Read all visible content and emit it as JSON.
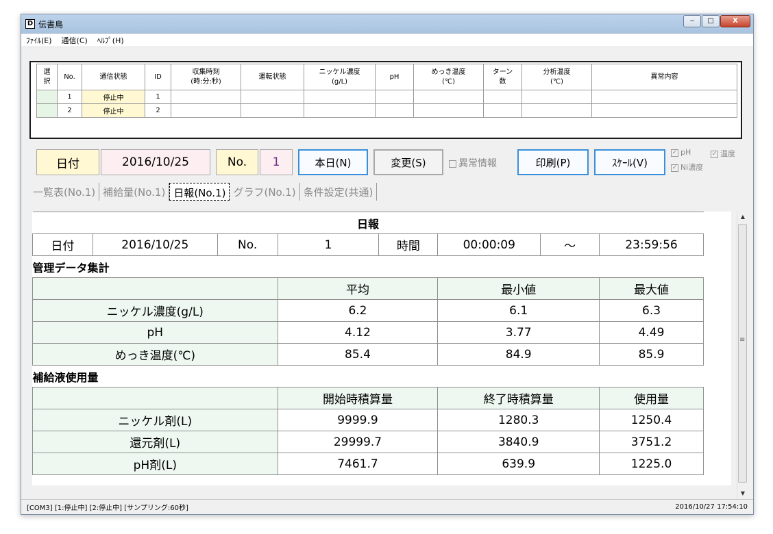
{
  "window": {
    "title": "伝書鳥",
    "app_icon": "D",
    "buttons": {
      "minimize": "‒",
      "maximize": "□",
      "close": "X"
    }
  },
  "menu": [
    {
      "label": "ﾌｧｲﾙ(E)"
    },
    {
      "label": "通信(C)"
    },
    {
      "label": "ﾍﾙﾌﾟ(H)"
    }
  ],
  "monitor": {
    "headers": [
      "選\n択",
      "No.",
      "通信状態",
      "ID",
      "収集時刻\n(時:分:秒)",
      "運転状態",
      "ニッケル濃度\n(g/L)",
      "pH",
      "めっき温度\n(℃)",
      "ターン\n数",
      "分析温度\n(℃)",
      "異常内容"
    ],
    "rows": [
      {
        "no": "1",
        "status": "停止中",
        "id": "1"
      },
      {
        "no": "2",
        "status": "停止中",
        "id": "2"
      }
    ]
  },
  "controls": {
    "date_label": "日付",
    "date_value": "2016/10/25",
    "no_label": "No.",
    "no_value": "1",
    "today_button": "本日(N)",
    "change_button": "変更(S)",
    "anomaly_label": "異常情報",
    "print_button": "印刷(P)",
    "scale_button": "ｽｹｰﾙ(V)",
    "check_ph": "pH",
    "check_temp": "温度",
    "check_ni": "Ni濃度"
  },
  "tabs": [
    {
      "label": "一覧表(No.1)"
    },
    {
      "label": "補給量(No.1)"
    },
    {
      "label": "日報(No.1)"
    },
    {
      "label": "グラフ(No.1)"
    },
    {
      "label": "条件設定(共通)"
    }
  ],
  "report": {
    "title": "日報",
    "date_label": "日付",
    "date_value": "2016/10/25",
    "no_label": "No.",
    "no_value": "1",
    "time_label": "時間",
    "time_start": "00:00:09",
    "time_sep": "～",
    "time_end": "23:59:56",
    "section1_title": "管理データ集計",
    "section1_headers": [
      "平均",
      "最小値",
      "最大値"
    ],
    "section1_rows": [
      {
        "label": "ニッケル濃度(g/L)",
        "values": [
          "6.2",
          "6.1",
          "6.3"
        ]
      },
      {
        "label": "pH",
        "values": [
          "4.12",
          "3.77",
          "4.49"
        ]
      },
      {
        "label": "めっき温度(℃)",
        "values": [
          "85.4",
          "84.9",
          "85.9"
        ]
      }
    ],
    "section2_title": "補給液使用量",
    "section2_headers": [
      "開始時積算量",
      "終了時積算量",
      "使用量"
    ],
    "section2_rows": [
      {
        "label": "ニッケル剤(L)",
        "values": [
          "9999.9",
          "1280.3",
          "1250.4"
        ]
      },
      {
        "label": "還元剤(L)",
        "values": [
          "29999.7",
          "3840.9",
          "3751.2"
        ]
      },
      {
        "label": "pH剤(L)",
        "values": [
          "7461.7",
          "639.9",
          "1225.0"
        ]
      }
    ]
  },
  "statusbar": {
    "left": "[COM3] [1:停止中] [2:停止中] [サンプリング:60秒]",
    "right": "2016/10/27 17:54:10"
  }
}
